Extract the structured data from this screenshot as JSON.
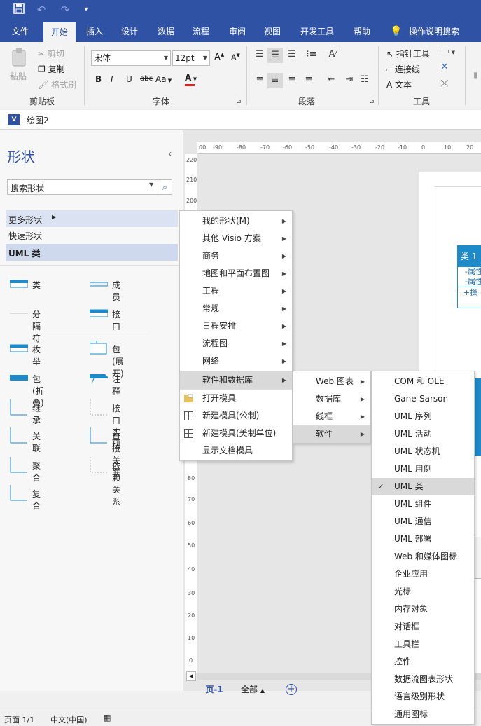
{
  "app": {
    "doc_title": "绘图2"
  },
  "tabs": [
    "文件",
    "开始",
    "插入",
    "设计",
    "数据",
    "流程",
    "审阅",
    "视图",
    "开发工具",
    "帮助"
  ],
  "tell_me": "操作说明搜索",
  "ribbon": {
    "clipboard": {
      "paste": "粘贴",
      "cut": "剪切",
      "copy": "复制",
      "format_painter": "格式刷",
      "label": "剪贴板"
    },
    "font": {
      "font_name": "宋体",
      "font_size": "12pt",
      "bold": "B",
      "italic": "I",
      "underline": "U",
      "strike": "abc",
      "case": "Aa",
      "color": "A",
      "label": "字体"
    },
    "paragraph": {
      "label": "段落"
    },
    "tools": {
      "pointer": "指针工具",
      "connector": "连接线",
      "text": "文本",
      "label": "工具"
    }
  },
  "shapes_pane": {
    "title": "形状",
    "search_placeholder": "搜索形状",
    "more_shapes": "更多形状",
    "quick_shapes": "快速形状",
    "stencil": "UML 类",
    "items": [
      {
        "label": "类",
        "icon": "class-shape-icon"
      },
      {
        "label": "成员",
        "icon": "member-shape-icon"
      },
      {
        "label": "分隔符",
        "icon": "separator-shape-icon"
      },
      {
        "label": "接口",
        "icon": "interface-shape-icon"
      },
      {
        "label": "枚举",
        "icon": "enum-shape-icon"
      },
      {
        "label": "包(展开)",
        "icon": "package-expanded-icon"
      },
      {
        "label": "包(折叠)",
        "icon": "package-collapsed-icon"
      },
      {
        "label": "注释",
        "icon": "note-shape-icon"
      },
      {
        "label": "继承",
        "icon": "inheritance-connector-icon"
      },
      {
        "label": "接口实现",
        "icon": "interface-realization-icon"
      },
      {
        "label": "关联",
        "icon": "association-connector-icon"
      },
      {
        "label": "直接关联",
        "icon": "directed-association-icon"
      },
      {
        "label": "聚合",
        "icon": "aggregation-connector-icon"
      },
      {
        "label": "依赖关系",
        "icon": "dependency-connector-icon"
      },
      {
        "label": "复合",
        "icon": "composition-connector-icon"
      }
    ]
  },
  "ruler": {
    "h_ticks": [
      "00",
      "-90",
      "-80",
      "-70",
      "-60",
      "-50",
      "-40",
      "-30",
      "-20",
      "-10",
      "0",
      "10",
      "20"
    ],
    "v_ticks": [
      "220",
      "210",
      "200",
      "80",
      "70",
      "60",
      "50",
      "40",
      "30",
      "20",
      "10",
      "0"
    ]
  },
  "canvas": {
    "class_title": "类 1",
    "attr1": "-属性",
    "attr2": "-属性",
    "op": "+操"
  },
  "page_tabs": {
    "page": "页-1",
    "all": "全部"
  },
  "menu_more": [
    {
      "label": "我的形状(M)",
      "submenu": true
    },
    {
      "label": "其他 Visio 方案",
      "submenu": true
    },
    {
      "label": "商务",
      "submenu": true
    },
    {
      "label": "地图和平面布置图",
      "submenu": true
    },
    {
      "label": "工程",
      "submenu": true
    },
    {
      "label": "常规",
      "submenu": true
    },
    {
      "label": "日程安排",
      "submenu": true
    },
    {
      "label": "流程图",
      "submenu": true
    },
    {
      "label": "网络",
      "submenu": true
    },
    {
      "label": "软件和数据库",
      "submenu": true
    },
    {
      "label": "打开模具",
      "submenu": false
    },
    {
      "label": "新建模具(公制)",
      "submenu": false
    },
    {
      "label": "新建模具(美制单位)",
      "submenu": false
    },
    {
      "label": "显示文档模具",
      "submenu": false
    }
  ],
  "menu_software": [
    {
      "label": "Web 图表"
    },
    {
      "label": "数据库"
    },
    {
      "label": "线框"
    },
    {
      "label": "软件"
    }
  ],
  "menu_software_sub": [
    "COM 和 OLE",
    "Gane-Sarson",
    "UML 序列",
    "UML 活动",
    "UML 状态机",
    "UML 用例",
    "UML 类",
    "UML 组件",
    "UML 通信",
    "UML 部署",
    "Web 和媒体图标",
    "企业应用",
    "光标",
    "内存对象",
    "对话框",
    "工具栏",
    "控件",
    "数据流图表形状",
    "语言级别形状",
    "通用图标"
  ],
  "status": {
    "page": "页面 1/1",
    "lang": "中文(中国)"
  },
  "colors": {
    "accent": "#2f52a5",
    "uml": "#1e8ac8"
  }
}
